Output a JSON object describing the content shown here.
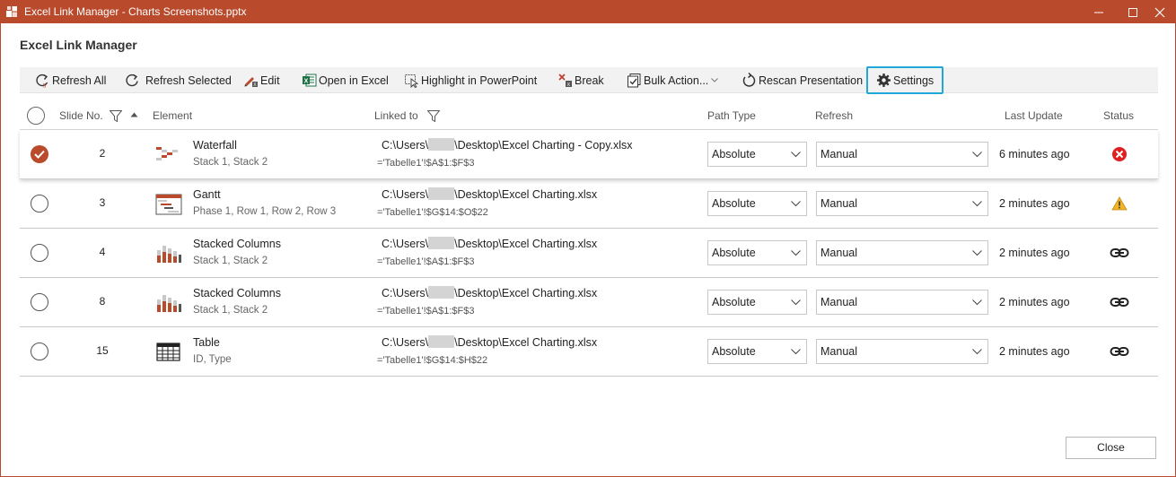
{
  "window": {
    "title": "Excel Link Manager - Charts Screenshots.pptx",
    "accent": "#b94a2c"
  },
  "heading": "Excel Link Manager",
  "toolbar": {
    "refresh_all": "Refresh All",
    "refresh_selected": "Refresh Selected",
    "edit": "Edit",
    "open_in_excel": "Open in Excel",
    "highlight": "Highlight in PowerPoint",
    "break": "Break",
    "bulk_actions": "Bulk Action...",
    "rescan": "Rescan Presentation",
    "settings": "Settings",
    "settings_highlight_color": "#1fa8d8"
  },
  "table": {
    "headers": {
      "slide_no": "Slide No.",
      "element": "Element",
      "linked_to": "Linked to",
      "path_type": "Path Type",
      "refresh": "Refresh",
      "last_update": "Last Update",
      "status": "Status"
    },
    "rows": [
      {
        "selected": true,
        "slide": "2",
        "icon": "waterfall-chart-icon",
        "name": "Waterfall",
        "sub": "Stack 1, Stack 2",
        "path_a": "C:\\Users\\",
        "path_b": "\\Desktop\\Excel Charting - Copy.xlsx",
        "range": "='Tabelle1'!$A$1:$F$3",
        "path_type": "Absolute",
        "refresh": "Manual",
        "updated": "6 minutes ago",
        "status": "error-icon"
      },
      {
        "selected": false,
        "slide": "3",
        "icon": "gantt-chart-icon",
        "name": "Gantt",
        "sub": "Phase 1, Row 1, Row 2, Row 3",
        "path_a": "C:\\Users\\",
        "path_b": "\\Desktop\\Excel Charting.xlsx",
        "range": "='Tabelle1'!$G$14:$O$22",
        "path_type": "Absolute",
        "refresh": "Manual",
        "updated": "2 minutes ago",
        "status": "warning-icon"
      },
      {
        "selected": false,
        "slide": "4",
        "icon": "stacked-columns-icon",
        "name": "Stacked Columns",
        "sub": "Stack 1, Stack 2",
        "path_a": "C:\\Users\\",
        "path_b": "\\Desktop\\Excel Charting.xlsx",
        "range": "='Tabelle1'!$A$1:$F$3",
        "path_type": "Absolute",
        "refresh": "Manual",
        "updated": "2 minutes ago",
        "status": "link-icon"
      },
      {
        "selected": false,
        "slide": "8",
        "icon": "stacked-columns-icon",
        "name": "Stacked Columns",
        "sub": "Stack 1, Stack 2",
        "path_a": "C:\\Users\\",
        "path_b": "\\Desktop\\Excel Charting.xlsx",
        "range": "='Tabelle1'!$A$1:$F$3",
        "path_type": "Absolute",
        "refresh": "Manual",
        "updated": "2 minutes ago",
        "status": "link-icon"
      },
      {
        "selected": false,
        "slide": "15",
        "icon": "table-icon",
        "name": "Table",
        "sub": "ID, Type",
        "path_a": "C:\\Users\\",
        "path_b": "\\Desktop\\Excel Charting.xlsx",
        "range": "='Tabelle1'!$G$14:$H$22",
        "path_type": "Absolute",
        "refresh": "Manual",
        "updated": "2 minutes ago",
        "status": "link-icon"
      }
    ]
  },
  "footer": {
    "close": "Close"
  }
}
